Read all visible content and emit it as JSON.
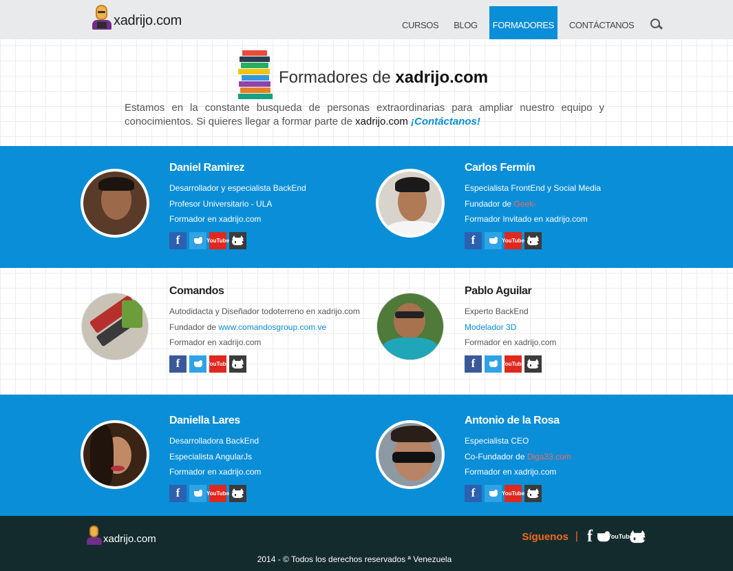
{
  "header": {
    "logo_text": "xadrijo.com",
    "nav": [
      {
        "label": "CURSOS",
        "active": false
      },
      {
        "label": "BLOG",
        "active": false
      },
      {
        "label": "FORMADORES",
        "active": true
      },
      {
        "label": "CONTÁCTANOS",
        "active": false
      }
    ],
    "search_icon": "search-icon"
  },
  "intro": {
    "title_prefix": "Formadores de",
    "title_brand": "xadrijo.com",
    "text": "Estamos en la constante busqueda de personas extraordinarias para ampliar nuestro equipo y conocimientos. Si quieres llegar a formar parte de",
    "brand": "xadrijo.com",
    "cta": "¡Contáctanos!"
  },
  "trainers": [
    {
      "name": "Daniel Ramirez",
      "lines": [
        {
          "text": "Desarrollador y especialista BackEnd"
        },
        {
          "text": "Profesor Universitario - ULA"
        },
        {
          "text": "Formador en xadrijo.com"
        }
      ]
    },
    {
      "name": "Carlos Fermín",
      "lines": [
        {
          "text": "Especialista FrontEnd y Social Media"
        },
        {
          "text": "Fundador de ",
          "link": "Geek-",
          "link_color": "red"
        },
        {
          "text": "Formador Invitado en xadrijo.com"
        }
      ]
    },
    {
      "name": "Comandos",
      "lines": [
        {
          "text": "Autodidacta y Diseñador todoterreno en xadrijo.com"
        },
        {
          "text": "Fundador de ",
          "link": "www.comandosgroup.com.ve",
          "link_color": "blue"
        },
        {
          "text": "Formador en xadrijo.com"
        }
      ]
    },
    {
      "name": "Pablo Aguilar",
      "lines": [
        {
          "text": "Experto BackEnd"
        },
        {
          "text": "",
          "link": "Modelador 3D",
          "link_color": "blue"
        },
        {
          "text": "Formador en xadrijo.com"
        }
      ]
    },
    {
      "name": "Daniella Lares",
      "lines": [
        {
          "text": "Desarrolladora BackEnd"
        },
        {
          "text": " Especialista AngularJs"
        },
        {
          "text": "Formador en xadrijo.com"
        }
      ]
    },
    {
      "name": "Antonio de la Rosa",
      "lines": [
        {
          "text": "Especialista CEO"
        },
        {
          "text": "Co-Fundador de ",
          "link": "Diga33.com",
          "link_color": "red"
        },
        {
          "text": "Formador en xadrijo.com"
        }
      ]
    }
  ],
  "social": {
    "facebook": "f",
    "youtube_top": "You",
    "youtube_bottom": "Tube"
  },
  "footer": {
    "logo_text": "xadrijo.com",
    "follow_label": "Síguenos",
    "separator": "|",
    "copyright": "2014 - © Todos los derechos reservados  ª Venezuela"
  },
  "colors": {
    "accent_blue": "#0a8ed8",
    "footer_bg": "#142b2e",
    "follow_orange": "#f26a1b",
    "link_red": "#f56a5a"
  }
}
